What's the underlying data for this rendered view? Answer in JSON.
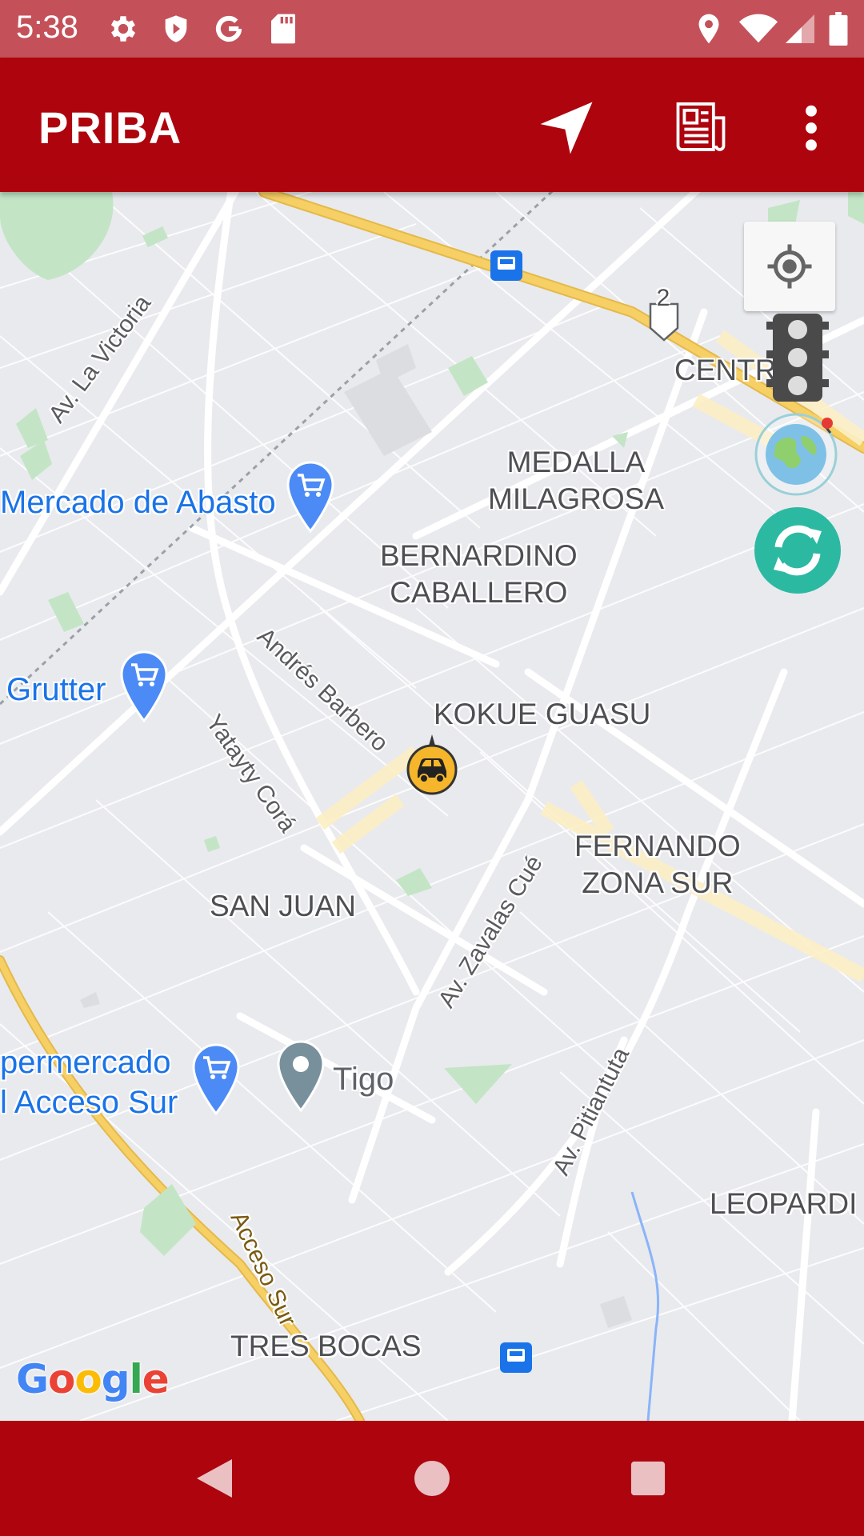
{
  "status_bar": {
    "time": "5:38",
    "icons": [
      "gear-icon",
      "shield-icon",
      "google-g-icon",
      "sd-card-icon",
      "location-icon",
      "wifi-icon",
      "signal-icon",
      "battery-icon"
    ]
  },
  "app_bar": {
    "title": "PRIBA",
    "actions": [
      "navigate-icon",
      "newspaper-icon",
      "more-vert-icon"
    ]
  },
  "map": {
    "area_labels": {
      "centro": "CENTRO",
      "medalla": "MEDALLA\nMILAGROSA",
      "bernardino": "BERNARDINO\nCABALLERO",
      "kokue": "KOKUE GUASU",
      "fernando": "FERNANDO\nZONA SUR",
      "san_juan": "SAN JUAN",
      "leopardi": "LEOPARDI",
      "tres_bocas": "TRES BOCAS"
    },
    "street_labels": {
      "la_victoria": "Av. La Victoria",
      "andres_barbero": "Andrés Barbero",
      "yatayty": "Yatayty Corá",
      "zavalas": "Av. Zavalas Cué",
      "pitiantuta": "Av. Pitiantuta",
      "acceso_sur": "Acceso Sur"
    },
    "route_shield": "2",
    "pois": {
      "abasto": "Mercado de Abasto",
      "grutter": "Grutter",
      "super_line1": "permercado",
      "super_line2": "l Acceso Sur",
      "tigo": "Tigo"
    },
    "attribution": "Google",
    "colors": {
      "map_bg": "#e9eaee",
      "road": "#ffffff",
      "highway": "#f6cf65",
      "park": "#c3e5c6",
      "poi_blue": "#1a73e8",
      "refresh": "#2cb9a2"
    }
  },
  "colors": {
    "status_bar": "#c45159",
    "app_bar": "#ad040d",
    "nav_bar": "#ad040d"
  },
  "nav_bar": {
    "buttons": [
      "back-icon",
      "home-icon",
      "recents-icon"
    ]
  }
}
